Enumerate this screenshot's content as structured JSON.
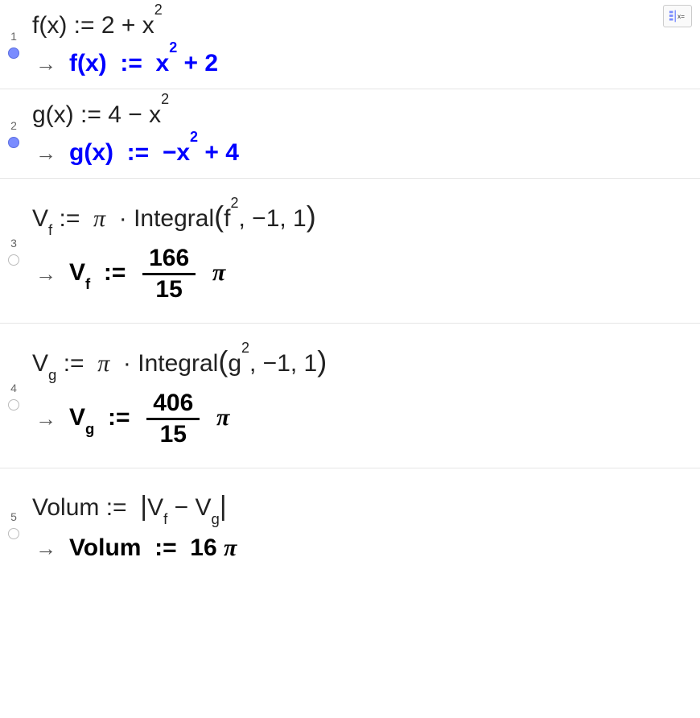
{
  "toolbar": {
    "substitute_label": "x="
  },
  "rows": [
    {
      "num": "1",
      "input": "f(x) := 2 + x²",
      "output": "f(x)  :=  x² + 2",
      "filled": true,
      "blue": true
    },
    {
      "num": "2",
      "input": "g(x) := 4 − x²",
      "output": "g(x)  :=  −x² + 4",
      "filled": true,
      "blue": true
    },
    {
      "num": "3",
      "input": "V_f :=  π  · Integral(f², −1, 1)",
      "output_prefix": "V_f  :=  ",
      "frac_num": "166",
      "frac_den": "15",
      "output_suffix": " π",
      "filled": false,
      "blue": false
    },
    {
      "num": "4",
      "input": "V_g :=  π  · Integral(g², −1, 1)",
      "output_prefix": "V_g  :=  ",
      "frac_num": "406",
      "frac_den": "15",
      "output_suffix": " π",
      "filled": false,
      "blue": false
    },
    {
      "num": "5",
      "input": "Volum :=  |V_f − V_g|",
      "output": "Volum  :=  16 π",
      "filled": false,
      "blue": false
    }
  ]
}
